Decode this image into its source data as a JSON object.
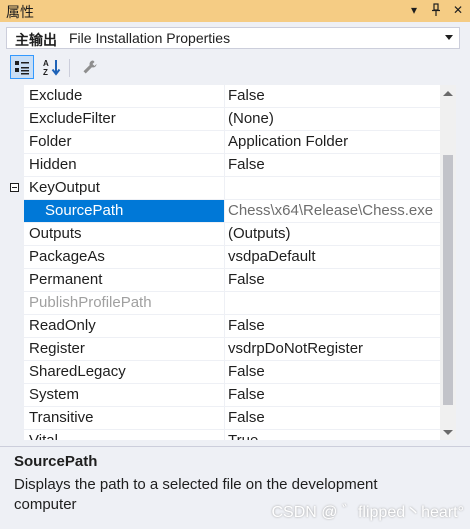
{
  "window": {
    "title": "属性"
  },
  "selector": {
    "bold": "主输出",
    "text": "File Installation Properties"
  },
  "rows": [
    {
      "name": "Exclude",
      "value": "False"
    },
    {
      "name": "ExcludeFilter",
      "value": "(None)"
    },
    {
      "name": "Folder",
      "value": "Application Folder"
    },
    {
      "name": "Hidden",
      "value": "False"
    },
    {
      "name": "KeyOutput",
      "value": ""
    },
    {
      "name": "SourcePath",
      "value": "Chess\\x64\\Release\\Chess.exe"
    },
    {
      "name": "Outputs",
      "value": "(Outputs)"
    },
    {
      "name": "PackageAs",
      "value": "vsdpaDefault"
    },
    {
      "name": "Permanent",
      "value": "False"
    },
    {
      "name": "PublishProfilePath",
      "value": ""
    },
    {
      "name": "ReadOnly",
      "value": "False"
    },
    {
      "name": "Register",
      "value": "vsdrpDoNotRegister"
    },
    {
      "name": "SharedLegacy",
      "value": "False"
    },
    {
      "name": "System",
      "value": "False"
    },
    {
      "name": "Transitive",
      "value": "False"
    },
    {
      "name": "Vital",
      "value": "True"
    }
  ],
  "description": {
    "title": "SourcePath",
    "text": "Displays the path to a selected file on the development computer"
  },
  "watermark": "CSDN @ ゛flipped丶heart°"
}
